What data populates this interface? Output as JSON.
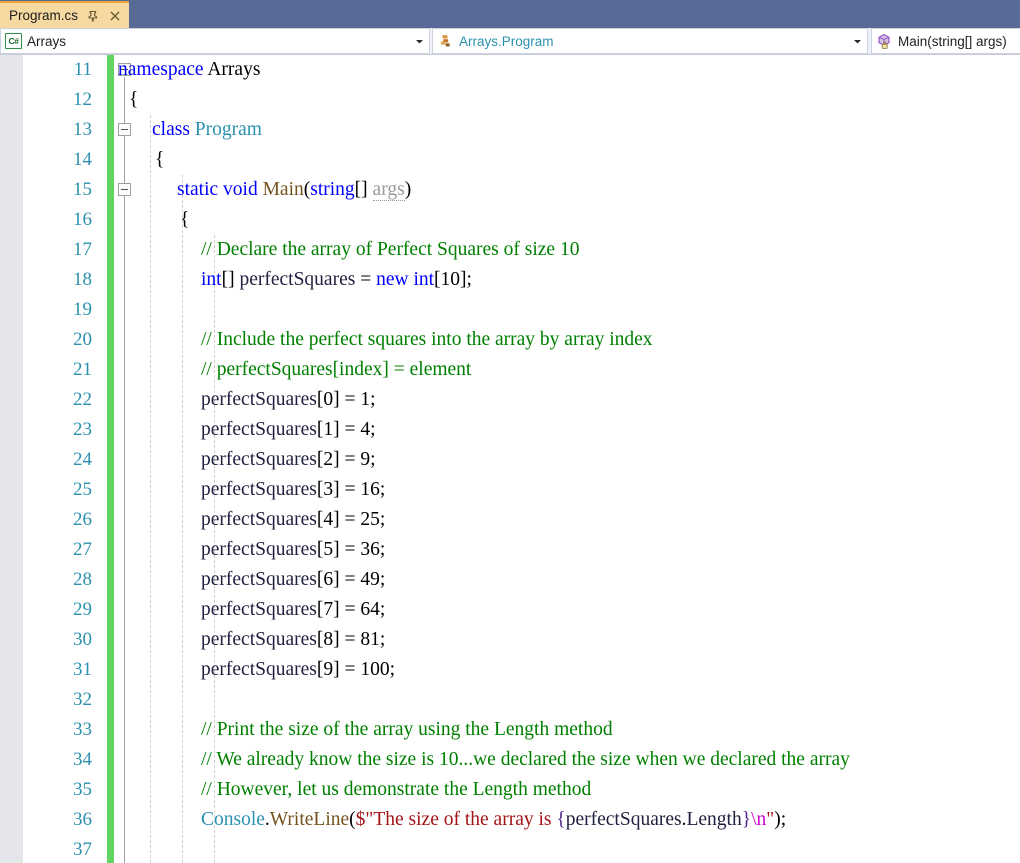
{
  "window": {
    "tab": {
      "title": "Program.cs",
      "pin_icon": "pin-icon",
      "close_icon": "close-icon"
    }
  },
  "navbar": {
    "project": {
      "icon": "csharp-file-icon",
      "badge_text": "C#",
      "value": "Arrays",
      "dropdown_icon": "chevron-down-icon"
    },
    "type": {
      "icon": "class-icon",
      "value": "Arrays.Program",
      "dropdown_icon": "chevron-down-icon"
    },
    "member": {
      "icon": "method-private-icon",
      "value": "Main(string[] args)"
    }
  },
  "editor": {
    "first_line_number": 11,
    "colors": {
      "keyword": "#0000ff",
      "type": "#2b91af",
      "comment": "#008000",
      "method": "#74531f",
      "string": "#a31515",
      "escape": "#cc00cc",
      "line_number": "#2b91af",
      "change_bar": "#60d660",
      "tab_background": "#f5d9a0",
      "tab_strip_background": "#5a6a97"
    },
    "lines": [
      {
        "n": 11,
        "text": "namespace Arrays"
      },
      {
        "n": 12,
        "text": "{"
      },
      {
        "n": 13,
        "text": "class Program"
      },
      {
        "n": 14,
        "text": "{"
      },
      {
        "n": 15,
        "text": "static void Main(string[] args)"
      },
      {
        "n": 16,
        "text": "{"
      },
      {
        "n": 17,
        "text": "// Declare the array of Perfect Squares of size 10"
      },
      {
        "n": 18,
        "text": "int[] perfectSquares = new int[10];"
      },
      {
        "n": 19,
        "text": ""
      },
      {
        "n": 20,
        "text": "// Include the perfect squares into the array by array index"
      },
      {
        "n": 21,
        "text": "// perfectSquares[index] = element"
      },
      {
        "n": 22,
        "text": "perfectSquares[0] = 1;"
      },
      {
        "n": 23,
        "text": "perfectSquares[1] = 4;"
      },
      {
        "n": 24,
        "text": "perfectSquares[2] = 9;"
      },
      {
        "n": 25,
        "text": "perfectSquares[3] = 16;"
      },
      {
        "n": 26,
        "text": "perfectSquares[4] = 25;"
      },
      {
        "n": 27,
        "text": "perfectSquares[5] = 36;"
      },
      {
        "n": 28,
        "text": "perfectSquares[6] = 49;"
      },
      {
        "n": 29,
        "text": "perfectSquares[7] = 64;"
      },
      {
        "n": 30,
        "text": "perfectSquares[8] = 81;"
      },
      {
        "n": 31,
        "text": "perfectSquares[9] = 100;"
      },
      {
        "n": 32,
        "text": ""
      },
      {
        "n": 33,
        "text": "// Print the size of the array using the Length method"
      },
      {
        "n": 34,
        "text": "// We already know the size is 10...we declared the size when we declared the array"
      },
      {
        "n": 35,
        "text": "// However, let us demonstrate the Length method"
      },
      {
        "n": 36,
        "text": "Console.WriteLine($\"The size of the array is {perfectSquares.Length}\\n\");"
      },
      {
        "n": 37,
        "text": ""
      }
    ],
    "array_values": [
      1,
      4,
      9,
      16,
      25,
      36,
      49,
      64,
      81,
      100
    ]
  }
}
